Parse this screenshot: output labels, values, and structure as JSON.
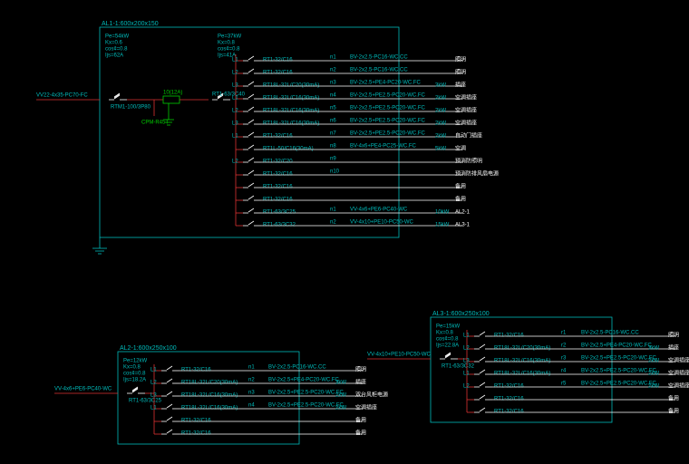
{
  "panels": {
    "p1": {
      "title": "AL1-1:600x200x150",
      "summary": [
        "Pe=54kW",
        "Kx=0.6",
        "cos¢=0.8",
        "Ijs=62A"
      ],
      "summary2": [
        "Pe=37kW",
        "Kx=0.8",
        "cos¢=0.8",
        "Ijs=41A"
      ],
      "incoming_cable": "VV22-4x35-PC70-FC",
      "incoming_breaker": "RTM1-100/3P80",
      "tie": {
        "fuse": "10(12A)",
        "monitor": "CPM-R45T"
      },
      "sub_breaker": "RT1-63/3C40",
      "circuits": [
        {
          "id": "L1",
          "bkr": "RT1-32/C16",
          "n": "n1",
          "cbl": "BV-2x2.5-PC16-WC.CC",
          "load": "",
          "use": "照明"
        },
        {
          "id": "L2",
          "bkr": "RT1-32/C16",
          "n": "n2",
          "cbl": "BV-2x2.5-PC16-WC.CC",
          "load": "",
          "use": "照明"
        },
        {
          "id": "L3",
          "bkr": "RT18L-32L/C20(30mA)",
          "n": "n3",
          "cbl": "BV-2x2.5+PE4-PC20-WC.FC",
          "load": "3kW",
          "use": "插座"
        },
        {
          "id": "L1",
          "bkr": "RT18L-32L/C16(30mA)",
          "n": "n4",
          "cbl": "BV-2x2.5+PE2.5-PC20-WC.FC",
          "load": "2kW",
          "use": "空调插座"
        },
        {
          "id": "L2",
          "bkr": "RT18L-32L/C16(30mA)",
          "n": "n5",
          "cbl": "BV-2x2.5+PE2.5-PC20-WC.FC",
          "load": "2kW",
          "use": "空调插座"
        },
        {
          "id": "L3",
          "bkr": "RT18L-32L/C16(30mA)",
          "n": "n6",
          "cbl": "BV-2x2.5+PE2.5-PC20-WC.FC",
          "load": "2kW",
          "use": "空调插座"
        },
        {
          "id": "L1",
          "bkr": "RT1-32/C16",
          "n": "n7",
          "cbl": "BV-2x2.5+PE2.5-PC20-WC.FC",
          "load": "2kW",
          "use": "自动门插座"
        },
        {
          "id": "",
          "bkr": "RT1L-50/C16(30mA)",
          "n": "n8",
          "cbl": "BV-4x6+PE4-PC25-WC.FC",
          "load": "5kW",
          "use": "空调"
        },
        {
          "id": "L2",
          "bkr": "RT1-32/C20",
          "n": "n9",
          "cbl": "",
          "load": "",
          "use": "预消防照明"
        },
        {
          "id": "",
          "bkr": "RT1-32/C16",
          "n": "n10",
          "cbl": "",
          "load": "",
          "use": "预消防排风扇电源"
        },
        {
          "id": "",
          "bkr": "RT1-32/C16",
          "n": "",
          "cbl": "",
          "load": "",
          "use": "备用"
        },
        {
          "id": "",
          "bkr": "RT1-32/C16",
          "n": "",
          "cbl": "",
          "load": "",
          "use": "备用"
        },
        {
          "id": "",
          "bkr": "RT1-63/3C25",
          "n": "n1",
          "cbl": "VV-4x6+PE6-PC40-WC",
          "load": "10kW",
          "use": "AL2-1"
        },
        {
          "id": "",
          "bkr": "RT1-63/3C32",
          "n": "n2",
          "cbl": "VV-4x10+PE10-PC50-WC",
          "load": "15kW",
          "use": "AL3-1"
        }
      ]
    },
    "p2": {
      "title": "AL2-1:600x250x100",
      "summary": [
        "Pe=12kW",
        "Kx=0.8",
        "cos¢=0.8",
        "Ijs=18.2A"
      ],
      "incoming_cable": "VV-4x6+PE6-PC40-WC",
      "incoming_breaker": "RT1-63/3C25",
      "circuits": [
        {
          "id": "L1",
          "bkr": "RT1-32/C16",
          "n": "n1",
          "cbl": "BV-2x2.5-PC16-WC.CC",
          "load": "",
          "use": "照明"
        },
        {
          "id": "L2",
          "bkr": "RT18L-32L/C20(30mA)",
          "n": "n2",
          "cbl": "BV-2x2.5+PE4-PC20-WC.FC",
          "load": "3kW",
          "use": "插座"
        },
        {
          "id": "L3",
          "bkr": "RT18L-32L/C16(30mA)",
          "n": "n3",
          "cbl": "BV-2x2.5+PE2.5-PC20-WC.FC",
          "load": "2kW",
          "use": "双台风柜电源"
        },
        {
          "id": "L1",
          "bkr": "RT18L-32L/C16(30mA)",
          "n": "n4",
          "cbl": "BV-2x2.5+PE2.5-PC20-WC.FC",
          "load": "2kW",
          "use": "空调插座"
        },
        {
          "id": "",
          "bkr": "RT1-32/C16",
          "n": "",
          "cbl": "",
          "load": "",
          "use": "备用"
        },
        {
          "id": "",
          "bkr": "RT1-32/C16",
          "n": "",
          "cbl": "",
          "load": "",
          "use": "备用"
        }
      ]
    },
    "p3": {
      "title": "AL3-1:600x250x100",
      "summary": [
        "Pe=15kW",
        "Kx=0.8",
        "cos¢=0.8",
        "Ijs=22.8A"
      ],
      "incoming_cable": "VV-4x10+PE10-PC50-WC",
      "incoming_breaker": "RT1-63/3C32",
      "circuits": [
        {
          "id": "L1",
          "bkr": "RT1-32/C16",
          "n": "r1",
          "cbl": "BV-2x2.5-PC16-WC.CC",
          "load": "",
          "use": "照明"
        },
        {
          "id": "L2",
          "bkr": "RT18L-32L/C20(30mA)",
          "n": "r2",
          "cbl": "BV-2x2.5+PE4-PC20-WC.FC",
          "load": "3kW",
          "use": "插座"
        },
        {
          "id": "L3",
          "bkr": "RT18L-32L/C16(30mA)",
          "n": "r3",
          "cbl": "BV-2x2.5+PE2.5-PC20-WC.FC",
          "load": "2kW",
          "use": "空调插座"
        },
        {
          "id": "L1",
          "bkr": "RT18L-32L/C16(30mA)",
          "n": "r4",
          "cbl": "BV-2x2.5+PE2.5-PC20-WC.FC",
          "load": "2kW",
          "use": "空调插座"
        },
        {
          "id": "L2",
          "bkr": "RT1-32/C16",
          "n": "r5",
          "cbl": "BV-2x2.5+PE2.5-PC20-WC.FC",
          "load": "2kW",
          "use": "空调插座"
        },
        {
          "id": "",
          "bkr": "RT1-32/C16",
          "n": "",
          "cbl": "",
          "load": "",
          "use": "备用"
        },
        {
          "id": "",
          "bkr": "RT1-32/C16",
          "n": "",
          "cbl": "",
          "load": "",
          "use": "备用"
        }
      ]
    }
  },
  "chart_data": {
    "type": "table",
    "note": "Electrical single-line panel schedules; see panels.* for circuit data"
  }
}
